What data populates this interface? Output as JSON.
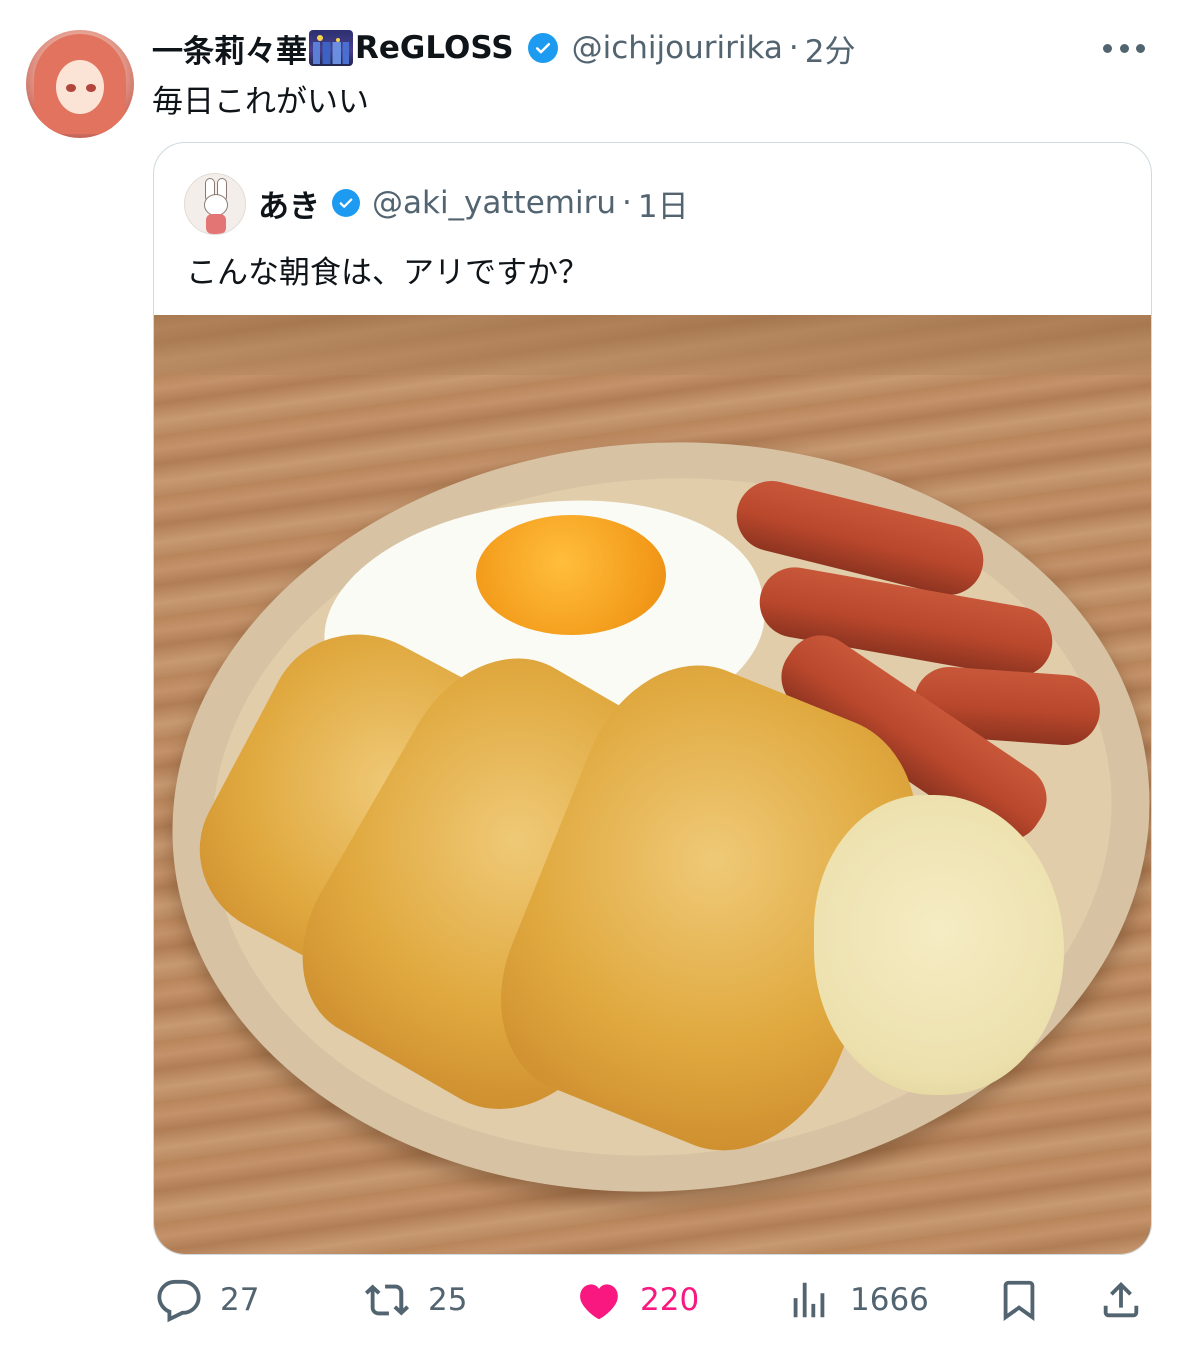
{
  "tweet": {
    "display_name": "一条莉々華",
    "display_name_suffix": "ReGLOSS",
    "handle": "@ichijouririka",
    "separator": "·",
    "time": "2分",
    "text": "毎日これがいい"
  },
  "quote": {
    "display_name": "あき",
    "handle": "@aki_yattemiru",
    "separator": "·",
    "time": "1日",
    "text": "こんな朝食は、アリですか？"
  },
  "actions": {
    "replies": "27",
    "retweets": "25",
    "likes": "220",
    "views": "1666"
  },
  "icons": {
    "verified": "verified-badge-icon",
    "more": "more-horizontal-icon",
    "reply": "reply-bubble-icon",
    "retweet": "retweet-icon",
    "like": "heart-icon",
    "views": "bar-chart-icon",
    "bookmark": "bookmark-icon",
    "share": "share-icon"
  },
  "colors": {
    "verified_blue": "#1d9bf0",
    "like_pink": "#f91880",
    "secondary_text": "#536471",
    "border": "#cfd9de"
  }
}
